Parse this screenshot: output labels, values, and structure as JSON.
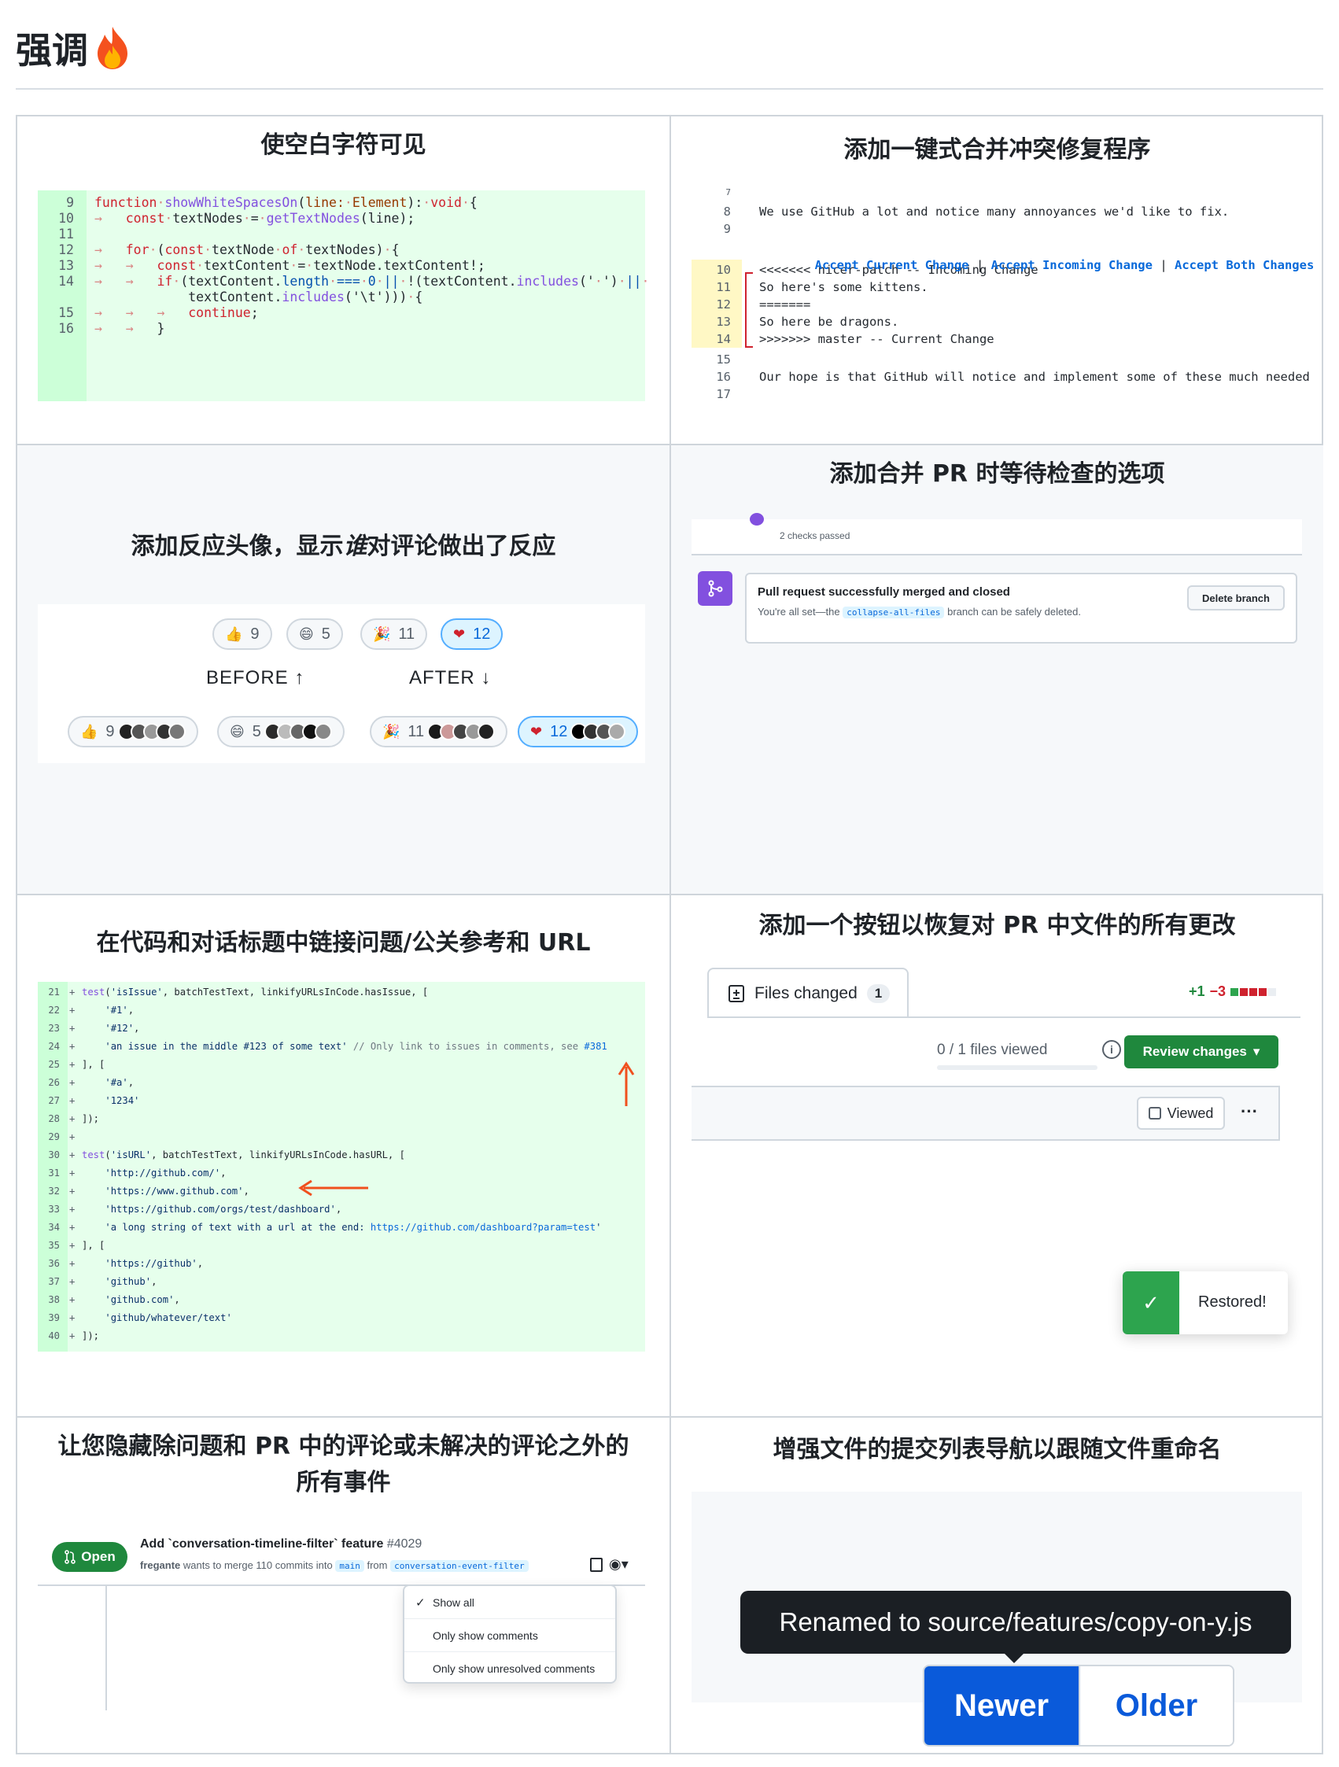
{
  "page": {
    "title": "强调",
    "title_icon": "fire-icon"
  },
  "cells": {
    "whitespace": {
      "title": "使空白字符可见",
      "lines": [
        {
          "n": "9",
          "code": "function·showWhiteSpacesOn(line:·Element):·void·{"
        },
        {
          "n": "10",
          "code": "→   const·textNodes·=·getTextNodes(line);"
        },
        {
          "n": "11",
          "code": ""
        },
        {
          "n": "12",
          "code": "→   for·(const·textNode·of·textNodes)·{"
        },
        {
          "n": "13",
          "code": "→   →   const·textContent·=·textNode.textContent!;"
        },
        {
          "n": "14",
          "code": "→   →   if·(textContent.length·===·0·||·!(textContent.includes('·')·||·"
        },
        {
          "n": "",
          "code": "            textContent.includes('\\t')))·{"
        },
        {
          "n": "15",
          "code": "→   →   →   continue;"
        },
        {
          "n": "16",
          "code": "→   →   }"
        }
      ]
    },
    "conflict": {
      "title": "添加一键式合并冲突修复程序",
      "top_line": "7",
      "lines": [
        {
          "n": "8",
          "code": "We use GitHub a lot and notice many annoyances we'd like to fix."
        },
        {
          "n": "9",
          "code": ""
        }
      ],
      "actions": [
        "Accept Current Change",
        "Accept Incoming Change",
        "Accept Both Changes"
      ],
      "action_sep": "|",
      "conflict_lines": [
        {
          "n": "10",
          "code": "<<<<<<< nicer-patch -- Incoming Change"
        },
        {
          "n": "11",
          "code": "So here's some kittens."
        },
        {
          "n": "12",
          "code": "======="
        },
        {
          "n": "13",
          "code": "So here be dragons."
        },
        {
          "n": "14",
          "code": ">>>>>>> master -- Current Change"
        }
      ],
      "tail_lines": [
        {
          "n": "15",
          "code": ""
        },
        {
          "n": "16",
          "code": "Our hope is that GitHub will notice and implement some of these much needed"
        },
        {
          "n": "17",
          "code": ""
        }
      ]
    },
    "reactions": {
      "title": "添加反应头像，显示",
      "title_em": "谁",
      "title_tail": "对评论做出了反应",
      "before_label": "BEFORE ↑",
      "after_label": "AFTER ↓",
      "top": [
        {
          "emoji": "👍",
          "count": "9"
        },
        {
          "emoji": "😄",
          "count": "5"
        },
        {
          "emoji": "🎉",
          "count": "11"
        },
        {
          "emoji": "❤",
          "count": "12"
        }
      ],
      "bottom": [
        {
          "emoji": "👍",
          "count": "9"
        },
        {
          "emoji": "😄",
          "count": "5"
        },
        {
          "emoji": "🎉",
          "count": "11"
        },
        {
          "emoji": "❤",
          "count": "12"
        }
      ],
      "colors": {
        "active_bg": "#ddf4ff",
        "active_border": "#54aeff",
        "active_text": "#0969da"
      }
    },
    "merge": {
      "title": "添加合并 PR 时等待检查的选项",
      "checks": "2 checks passed",
      "card_title": "Pull request successfully merged and closed",
      "card_pre": "You're all set—the",
      "card_branch": "collapse-all-files",
      "card_post": "branch can be safely deleted.",
      "delete_label": "Delete branch",
      "icon": "merge-icon",
      "colors": {
        "merged": "#8250df"
      }
    },
    "links": {
      "title": "在代码和对话标题中链接问题/公关参考和 URL",
      "lines": [
        {
          "n": "21",
          "code": "test('isIssue', batchTestText, linkifyURLsInCode.hasIssue, ["
        },
        {
          "n": "22",
          "code": "    '#1',"
        },
        {
          "n": "23",
          "code": "    '#12',"
        },
        {
          "n": "24",
          "code": "    'an issue in the middle #123 of some text' // Only link to issues in comments, see #381"
        },
        {
          "n": "25",
          "code": "], ["
        },
        {
          "n": "26",
          "code": "    '#a',"
        },
        {
          "n": "27",
          "code": "    '1234'"
        },
        {
          "n": "28",
          "code": "]);"
        },
        {
          "n": "29",
          "code": ""
        },
        {
          "n": "30",
          "code": "test('isURL', batchTestText, linkifyURLsInCode.hasURL, ["
        },
        {
          "n": "31",
          "code": "    'http://github.com/',"
        },
        {
          "n": "32",
          "code": "    'https://www.github.com',"
        },
        {
          "n": "33",
          "code": "    'https://github.com/orgs/test/dashboard',"
        },
        {
          "n": "34",
          "code": "    'a long string of text with a url at the end: https://github.com/dashboard?param=test'"
        },
        {
          "n": "35",
          "code": "], ["
        },
        {
          "n": "36",
          "code": "    'https://github',"
        },
        {
          "n": "37",
          "code": "    'github',"
        },
        {
          "n": "38",
          "code": "    'github.com',"
        },
        {
          "n": "39",
          "code": "    'github/whatever/text'"
        },
        {
          "n": "40",
          "code": "]);"
        }
      ],
      "plus": "+",
      "colors": {
        "arrow": "#f0501e"
      }
    },
    "restore": {
      "title": "添加一个按钮以恢复对 PR 中文件的所有更改",
      "tab_label": "Files changed",
      "tab_count": "1",
      "diff_add": "+1",
      "diff_del": "−3",
      "viewed_progress": "0 / 1 files viewed",
      "review_label": "Review changes",
      "viewed_label": "Viewed",
      "more": "···",
      "toast_label": "Restored!",
      "colors": {
        "green": "#1f883d",
        "red": "#cf222e"
      }
    },
    "hide": {
      "title_line1": "让您隐藏除问题和 PR 中的评论或未解决的评论之外的",
      "title_line2": "所有事件",
      "badge": "Open",
      "pr_title": "Add `conversation-timeline-filter` feature",
      "pr_number": "#4029",
      "author": "fregante",
      "merge_text": "wants to merge 110 commits into",
      "base": "main",
      "from": "from",
      "head": "conversation-event-filter",
      "menu": [
        "Show all",
        "Only show comments",
        "Only show unresolved comments"
      ],
      "selected": "Show all"
    },
    "rename": {
      "title": "增强文件的提交列表导航以跟随文件重命名",
      "tooltip": "Renamed to source/features/copy-on-y.js",
      "newer": "Newer",
      "older": "Older",
      "colors": {
        "primary": "#0a5ada"
      }
    }
  }
}
